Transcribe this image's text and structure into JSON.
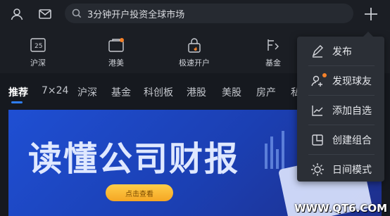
{
  "header": {
    "search_placeholder": "3分钟开户投资全球市场",
    "icons": [
      "user-icon",
      "mail-icon",
      "search-icon",
      "plus-icon"
    ]
  },
  "quick_access": [
    {
      "label": "沪深",
      "icon": "hs-index-icon"
    },
    {
      "label": "港美",
      "icon": "hk-us-icon"
    },
    {
      "label": "极速开户",
      "icon": "lock-fire-icon"
    },
    {
      "label": "基金",
      "icon": "fund-icon"
    }
  ],
  "tabs": [
    "推荐",
    "7×24",
    "沪深",
    "基金",
    "科创板",
    "港股",
    "美股",
    "房产",
    "私"
  ],
  "active_tab": "推荐",
  "banner": {
    "title": "读懂公司财报",
    "button_label": "点击查看"
  },
  "popup_menu": {
    "items": [
      {
        "label": "发布",
        "icon": "pen-icon"
      },
      {
        "label": "发现球友",
        "icon": "add-friend-icon"
      },
      {
        "label": "添加自选",
        "icon": "chart-line-icon"
      },
      {
        "label": "创建组合",
        "icon": "portfolio-icon"
      },
      {
        "label": "日间模式",
        "icon": "sun-icon"
      }
    ]
  },
  "watermark": "WWW.QT6.COM",
  "colors": {
    "accent": "#2f7ef5",
    "notify": "#f5822a",
    "banner": "#1f4fd3"
  }
}
